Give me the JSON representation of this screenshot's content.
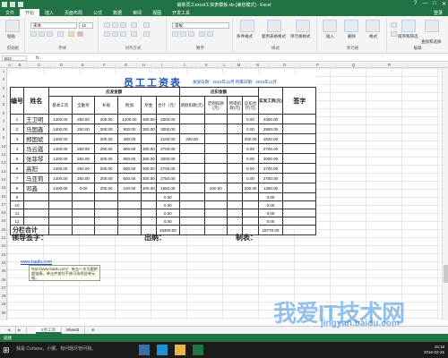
{
  "window": {
    "title": "最新员工excel工资表模板.xls [兼容模式] - Excel",
    "controls": [
      "?",
      "—",
      "□",
      "✕"
    ]
  },
  "ribbon_tabs": [
    "文件",
    "开始",
    "插入",
    "页面布局",
    "公式",
    "数据",
    "审阅",
    "视图",
    "开发工具"
  ],
  "ribbon_login": "登录",
  "ribbon": {
    "paste": "粘贴",
    "font_name": "宋体",
    "font_size": "12",
    "number_format": "常规",
    "groups": [
      "剪贴板",
      "字体",
      "对齐方式",
      "数字",
      "样式",
      "单元格",
      "编辑"
    ],
    "buttons": [
      "条件格式",
      "套用表格格式",
      "单元格样式",
      "插入",
      "删除",
      "格式",
      "排序和筛选",
      "查找和选择"
    ]
  },
  "formula_bar": {
    "name_box": "B22",
    "fx": "fx"
  },
  "columns": [
    "A",
    "B",
    "C",
    "D",
    "E",
    "F",
    "G",
    "H",
    "I",
    "J",
    "K",
    "L",
    "M",
    "N",
    "O",
    "P",
    "Q",
    "R"
  ],
  "rows": [
    "1",
    "2",
    "3",
    "4",
    "5",
    "6",
    "7",
    "8",
    "9",
    "10",
    "11",
    "12",
    "13",
    "14",
    "15",
    "16",
    "17",
    "18",
    "19",
    "20",
    "21",
    "22",
    "23",
    "24",
    "25",
    "26",
    "27",
    "28",
    "29",
    "30"
  ],
  "sheet": {
    "title": "员工工资表",
    "date_line": "发放日期：2015年12月  所属日期：2015年11月",
    "headers": {
      "no": "编号",
      "name": "姓名",
      "payable": "应发金额",
      "deduct": "应扣金额",
      "actual": "实发工资(元)",
      "sign": "签字",
      "sub": [
        "基本工资",
        "全勤奖",
        "补助",
        "附加",
        "奖金",
        "合计（元）",
        "请假扣款(元)",
        "迟到扣款(元)",
        "所得扣款(元)",
        "应扣合计(元)"
      ]
    },
    "rows": [
      {
        "no": "1",
        "name": "王卫明",
        "vals": [
          "1400.00",
          "250.00",
          "200.00",
          "1200.00",
          "300.00",
          "2000.00",
          "",
          "",
          "",
          "0.00",
          "2300.00"
        ]
      },
      {
        "no": "2",
        "name": "马国鑫",
        "vals": [
          "1400.00",
          "250.00",
          "200.00",
          "900.00",
          "300.00",
          "3000.00",
          "",
          "",
          "",
          "0.00",
          "2900.00"
        ]
      },
      {
        "no": "3",
        "name": "郑国斌",
        "vals": [
          "1400.00",
          "",
          "200.00",
          "400.00",
          "",
          "2100.00",
          "330.00",
          "",
          "",
          "330.00",
          "1820.00"
        ]
      },
      {
        "no": "4",
        "name": "马云霞",
        "vals": [
          "1400.00",
          "250.00",
          "200.00",
          "900.00",
          "300.00",
          "2700.00",
          "",
          "",
          "",
          "0.00",
          "2700.00"
        ]
      },
      {
        "no": "5",
        "name": "张菲琴",
        "vals": [
          "1400.00",
          "250.00",
          "200.00",
          "800.00",
          "300.00",
          "3000.00",
          "",
          "",
          "",
          "0.00",
          "3000.00"
        ]
      },
      {
        "no": "6",
        "name": "高阳",
        "vals": [
          "1400.00",
          "250.00",
          "200.00",
          "600.00",
          "300.00",
          "2700.00",
          "",
          "",
          "",
          "0.00",
          "2700.00"
        ]
      },
      {
        "no": "7",
        "name": "马亚莉",
        "vals": [
          "1400.00",
          "250.00",
          "200.00",
          "600.00",
          "300.00",
          "2750.00",
          "",
          "",
          "",
          "0.00",
          "2750.00"
        ]
      },
      {
        "no": "8",
        "name": "邓鑫",
        "vals": [
          "1400.00",
          "0.00",
          "200.00",
          "100.00",
          "300.00",
          "1650.00",
          "",
          "200.00",
          "",
          "200.00",
          "1450.00"
        ]
      },
      {
        "no": "9",
        "name": "",
        "vals": [
          "",
          "",
          "",
          "",
          "",
          "0.00",
          "",
          "",
          "",
          "",
          "0.00"
        ]
      },
      {
        "no": "10",
        "name": "",
        "vals": [
          "",
          "",
          "",
          "",
          "",
          "0.00",
          "",
          "",
          "",
          "",
          "0.00"
        ]
      },
      {
        "no": "11",
        "name": "",
        "vals": [
          "",
          "",
          "",
          "",
          "",
          "0.00",
          "",
          "",
          "",
          "",
          "0.00"
        ]
      },
      {
        "no": "12",
        "name": "",
        "vals": [
          "",
          "",
          "",
          "",
          "",
          "0.00",
          "",
          "",
          "",
          "",
          "0.00"
        ]
      }
    ],
    "total_label": "分栏合计",
    "total_values": {
      "sum": "19300.00",
      "actual": "18770.00"
    },
    "sign_labels": [
      "领导签字：",
      "出纳：",
      "制表："
    ]
  },
  "link_text": "www.baidu.com",
  "tooltip": "http://www.baidu.com/ - 单击一次可跟踪超链接。单击并按住不放可选择此单元格。",
  "sheet_tabs": [
    "5月工资",
    "Sheet3"
  ],
  "add_sheet": "⊕",
  "status": "就绪",
  "taskbar": {
    "search": "我是 Cortana，小娜。有问题尽管问我。",
    "time": "15:18",
    "date": "2016-02-25"
  },
  "watermark": {
    "main": "我爱IT技术网",
    "url": "jingyan.baidu.com"
  }
}
